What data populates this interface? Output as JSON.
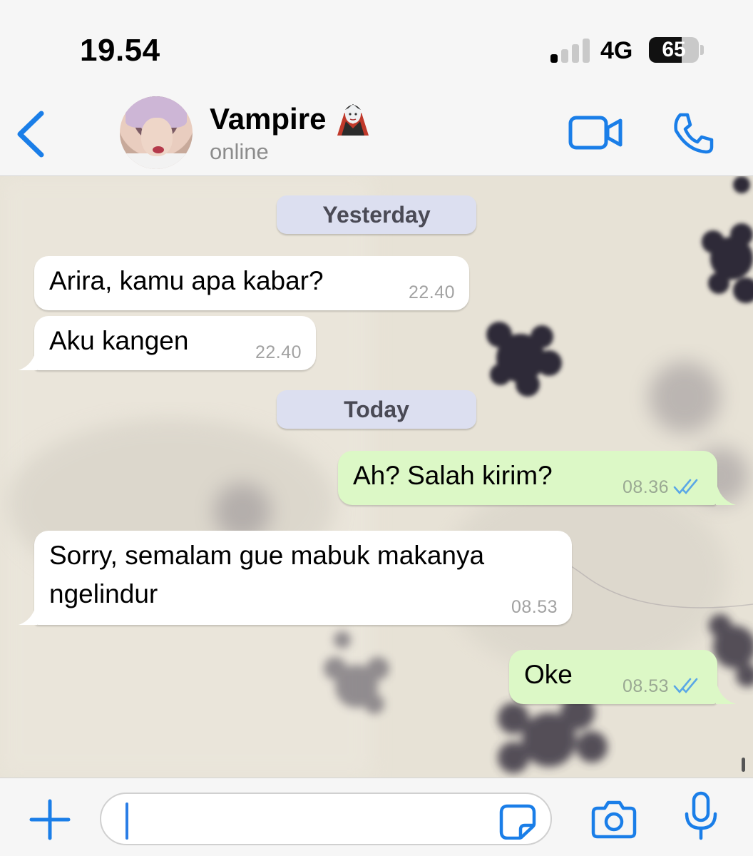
{
  "status_bar": {
    "time": "19.54",
    "network": "4G",
    "battery_percent": "65",
    "battery_level": 0.65,
    "signal_bars_active": 1,
    "signal_bars_total": 4
  },
  "header": {
    "back_icon": "chevron-left-icon",
    "contact_name": "Vampire",
    "contact_emoji": "vampire-emoji",
    "contact_status": "online",
    "video_icon": "video-camera-icon",
    "call_icon": "phone-icon"
  },
  "chat": {
    "dates": {
      "yesterday": "Yesterday",
      "today": "Today"
    },
    "messages": [
      {
        "direction": "incoming",
        "text": "Arira, kamu apa kabar?",
        "time": "22.40"
      },
      {
        "direction": "incoming",
        "text": "Aku kangen",
        "time": "22.40"
      },
      {
        "direction": "outgoing",
        "text": "Ah? Salah kirim?",
        "time": "08.36",
        "status": "read"
      },
      {
        "direction": "incoming",
        "text_line1": "Sorry, semalam gue mabuk makanya",
        "text_line2": "ngelindur",
        "time": "08.53"
      },
      {
        "direction": "outgoing",
        "text": "Oke",
        "time": "08.53",
        "status": "read"
      }
    ]
  },
  "input_bar": {
    "add_icon": "plus-icon",
    "message_value": "",
    "sticker_icon": "sticker-icon",
    "camera_icon": "camera-icon",
    "mic_icon": "microphone-icon"
  },
  "colors": {
    "accent": "#1a7ee8",
    "incoming_bubble": "#ffffff",
    "outgoing_bubble": "#dcf8c6",
    "date_pill": "#dcdff0",
    "read_ticks": "#5aa7e6"
  }
}
